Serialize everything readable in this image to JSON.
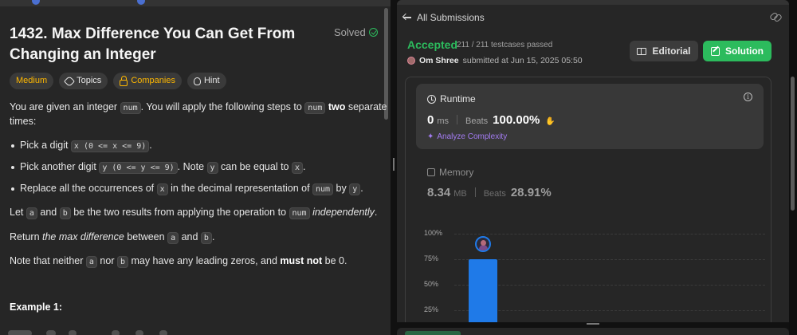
{
  "problem": {
    "title": "1432. Max Difference You Can Get From Changing an Integer",
    "status": "Solved",
    "tags": {
      "difficulty": "Medium",
      "topics": "Topics",
      "companies": "Companies",
      "hint": "Hint"
    },
    "description": {
      "p1_a": "You are given an integer ",
      "p1_code": "num",
      "p1_b": ". You will apply the following steps to ",
      "p1_code2": "num",
      "p1_bold": "two",
      "p1_c": " separate",
      "p1_d": "times:",
      "b1_a": "Pick a digit ",
      "b1_code": "x (0 <= x <= 9)",
      "b1_b": ".",
      "b2_a": "Pick another digit ",
      "b2_code": "y (0 <= y <= 9)",
      "b2_b": ". Note ",
      "b2_code2": "y",
      "b2_c": " can be equal to ",
      "b2_code3": "x",
      "b2_d": ".",
      "b3_a": "Replace all the occurrences of ",
      "b3_code": "x",
      "b3_b": " in the decimal representation of ",
      "b3_code2": "num",
      "b3_c": " by ",
      "b3_code3": "y",
      "b3_d": ".",
      "p2_a": "Let ",
      "p2_code": "a",
      "p2_b": " and ",
      "p2_code2": "b",
      "p2_c": " be the two results from applying the operation to ",
      "p2_code3": "num",
      "p2_italic": "independently",
      "p2_d": ".",
      "p3_a": "Return ",
      "p3_italic": "the max difference",
      "p3_b": " between ",
      "p3_code": "a",
      "p3_c": " and ",
      "p3_code2": "b",
      "p3_d": ".",
      "p4_a": "Note that neither ",
      "p4_code": "a",
      "p4_b": " nor ",
      "p4_code2": "b",
      "p4_c": " may have any leading zeros, and ",
      "p4_bold": "must not",
      "p4_d": " be 0."
    },
    "example_heading": "Example 1:"
  },
  "submission": {
    "back_label": "All Submissions",
    "result": "Accepted",
    "testcases": "211 / 211 testcases passed",
    "author": "Om Shree",
    "submitted": "submitted at Jun 15, 2025 05:50",
    "editorial_label": "Editorial",
    "solution_label": "Solution",
    "runtime": {
      "label": "Runtime",
      "value": "0",
      "unit": "ms",
      "beats_label": "Beats",
      "beats_pct": "100.00%",
      "analyze_label": "Analyze Complexity"
    },
    "memory": {
      "label": "Memory",
      "value": "8.34",
      "unit": "MB",
      "beats_label": "Beats",
      "beats_pct": "28.91%"
    }
  },
  "chart_data": {
    "type": "bar",
    "y_ticks": [
      "100%",
      "75%",
      "50%",
      "25%"
    ],
    "ylim": [
      0,
      100
    ],
    "bars": [
      {
        "value": 75,
        "highlighted": true
      }
    ]
  },
  "colors": {
    "accepted": "#2cbb5d",
    "medium": "#ffb800",
    "bar": "#1f7ae8",
    "analyze": "#a47cf3"
  }
}
